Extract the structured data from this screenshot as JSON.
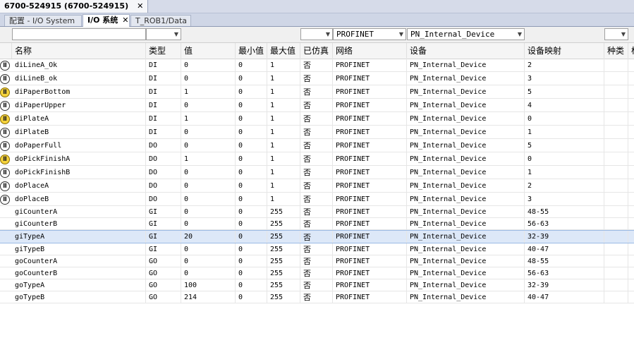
{
  "window": {
    "title": "6700-524915 (6700-524915)",
    "close": "✕"
  },
  "tabs": [
    {
      "label": "配置 - I/O System",
      "active": false
    },
    {
      "label": "I/O 系统",
      "active": true,
      "close": "✕"
    },
    {
      "label": "T_ROB1/Data",
      "active": false
    }
  ],
  "filters": {
    "name": "",
    "type": "",
    "network": "PROFINET",
    "device": "PN_Internal_Device",
    "category": ""
  },
  "columns": [
    "名称",
    "类型",
    "值",
    "最小值",
    "最大值",
    "已仿真",
    "网络",
    "设备",
    "设备映射",
    "种类",
    "标"
  ],
  "rows": [
    {
      "icon": "io-off",
      "name": "diLineA_Ok",
      "type": "DI",
      "value": "0",
      "min": "0",
      "max": "1",
      "sim": "否",
      "network": "PROFINET",
      "device": "PN_Internal_Device",
      "map": "2"
    },
    {
      "icon": "io-off",
      "name": "diLineB_ok",
      "type": "DI",
      "value": "0",
      "min": "0",
      "max": "1",
      "sim": "否",
      "network": "PROFINET",
      "device": "PN_Internal_Device",
      "map": "3"
    },
    {
      "icon": "io-on",
      "name": "diPaperBottom",
      "type": "DI",
      "value": "1",
      "min": "0",
      "max": "1",
      "sim": "否",
      "network": "PROFINET",
      "device": "PN_Internal_Device",
      "map": "5"
    },
    {
      "icon": "io-off",
      "name": "diPaperUpper",
      "type": "DI",
      "value": "0",
      "min": "0",
      "max": "1",
      "sim": "否",
      "network": "PROFINET",
      "device": "PN_Internal_Device",
      "map": "4"
    },
    {
      "icon": "io-on",
      "name": "diPlateA",
      "type": "DI",
      "value": "1",
      "min": "0",
      "max": "1",
      "sim": "否",
      "network": "PROFINET",
      "device": "PN_Internal_Device",
      "map": "0"
    },
    {
      "icon": "io-off",
      "name": "diPlateB",
      "type": "DI",
      "value": "0",
      "min": "0",
      "max": "1",
      "sim": "否",
      "network": "PROFINET",
      "device": "PN_Internal_Device",
      "map": "1"
    },
    {
      "icon": "io-off",
      "name": "doPaperFull",
      "type": "DO",
      "value": "0",
      "min": "0",
      "max": "1",
      "sim": "否",
      "network": "PROFINET",
      "device": "PN_Internal_Device",
      "map": "5"
    },
    {
      "icon": "io-on",
      "name": "doPickFinishA",
      "type": "DO",
      "value": "1",
      "min": "0",
      "max": "1",
      "sim": "否",
      "network": "PROFINET",
      "device": "PN_Internal_Device",
      "map": "0"
    },
    {
      "icon": "io-off",
      "name": "doPickFinishB",
      "type": "DO",
      "value": "0",
      "min": "0",
      "max": "1",
      "sim": "否",
      "network": "PROFINET",
      "device": "PN_Internal_Device",
      "map": "1"
    },
    {
      "icon": "io-off",
      "name": "doPlaceA",
      "type": "DO",
      "value": "0",
      "min": "0",
      "max": "1",
      "sim": "否",
      "network": "PROFINET",
      "device": "PN_Internal_Device",
      "map": "2"
    },
    {
      "icon": "io-off",
      "name": "doPlaceB",
      "type": "DO",
      "value": "0",
      "min": "0",
      "max": "1",
      "sim": "否",
      "network": "PROFINET",
      "device": "PN_Internal_Device",
      "map": "3"
    },
    {
      "icon": "",
      "name": "giCounterA",
      "type": "GI",
      "value": "0",
      "min": "0",
      "max": "255",
      "sim": "否",
      "network": "PROFINET",
      "device": "PN_Internal_Device",
      "map": "48-55"
    },
    {
      "icon": "",
      "name": "giCounterB",
      "type": "GI",
      "value": "0",
      "min": "0",
      "max": "255",
      "sim": "否",
      "network": "PROFINET",
      "device": "PN_Internal_Device",
      "map": "56-63"
    },
    {
      "icon": "",
      "name": "giTypeA",
      "type": "GI",
      "value": "20",
      "min": "0",
      "max": "255",
      "sim": "否",
      "network": "PROFINET",
      "device": "PN_Internal_Device",
      "map": "32-39",
      "selected": true
    },
    {
      "icon": "",
      "name": "giTypeB",
      "type": "GI",
      "value": "0",
      "min": "0",
      "max": "255",
      "sim": "否",
      "network": "PROFINET",
      "device": "PN_Internal_Device",
      "map": "40-47"
    },
    {
      "icon": "",
      "name": "goCounterA",
      "type": "GO",
      "value": "0",
      "min": "0",
      "max": "255",
      "sim": "否",
      "network": "PROFINET",
      "device": "PN_Internal_Device",
      "map": "48-55"
    },
    {
      "icon": "",
      "name": "goCounterB",
      "type": "GO",
      "value": "0",
      "min": "0",
      "max": "255",
      "sim": "否",
      "network": "PROFINET",
      "device": "PN_Internal_Device",
      "map": "56-63"
    },
    {
      "icon": "",
      "name": "goTypeA",
      "type": "GO",
      "value": "100",
      "min": "0",
      "max": "255",
      "sim": "否",
      "network": "PROFINET",
      "device": "PN_Internal_Device",
      "map": "32-39"
    },
    {
      "icon": "",
      "name": "goTypeB",
      "type": "GO",
      "value": "214",
      "min": "0",
      "max": "255",
      "sim": "否",
      "network": "PROFINET",
      "device": "PN_Internal_Device",
      "map": "40-47"
    }
  ]
}
